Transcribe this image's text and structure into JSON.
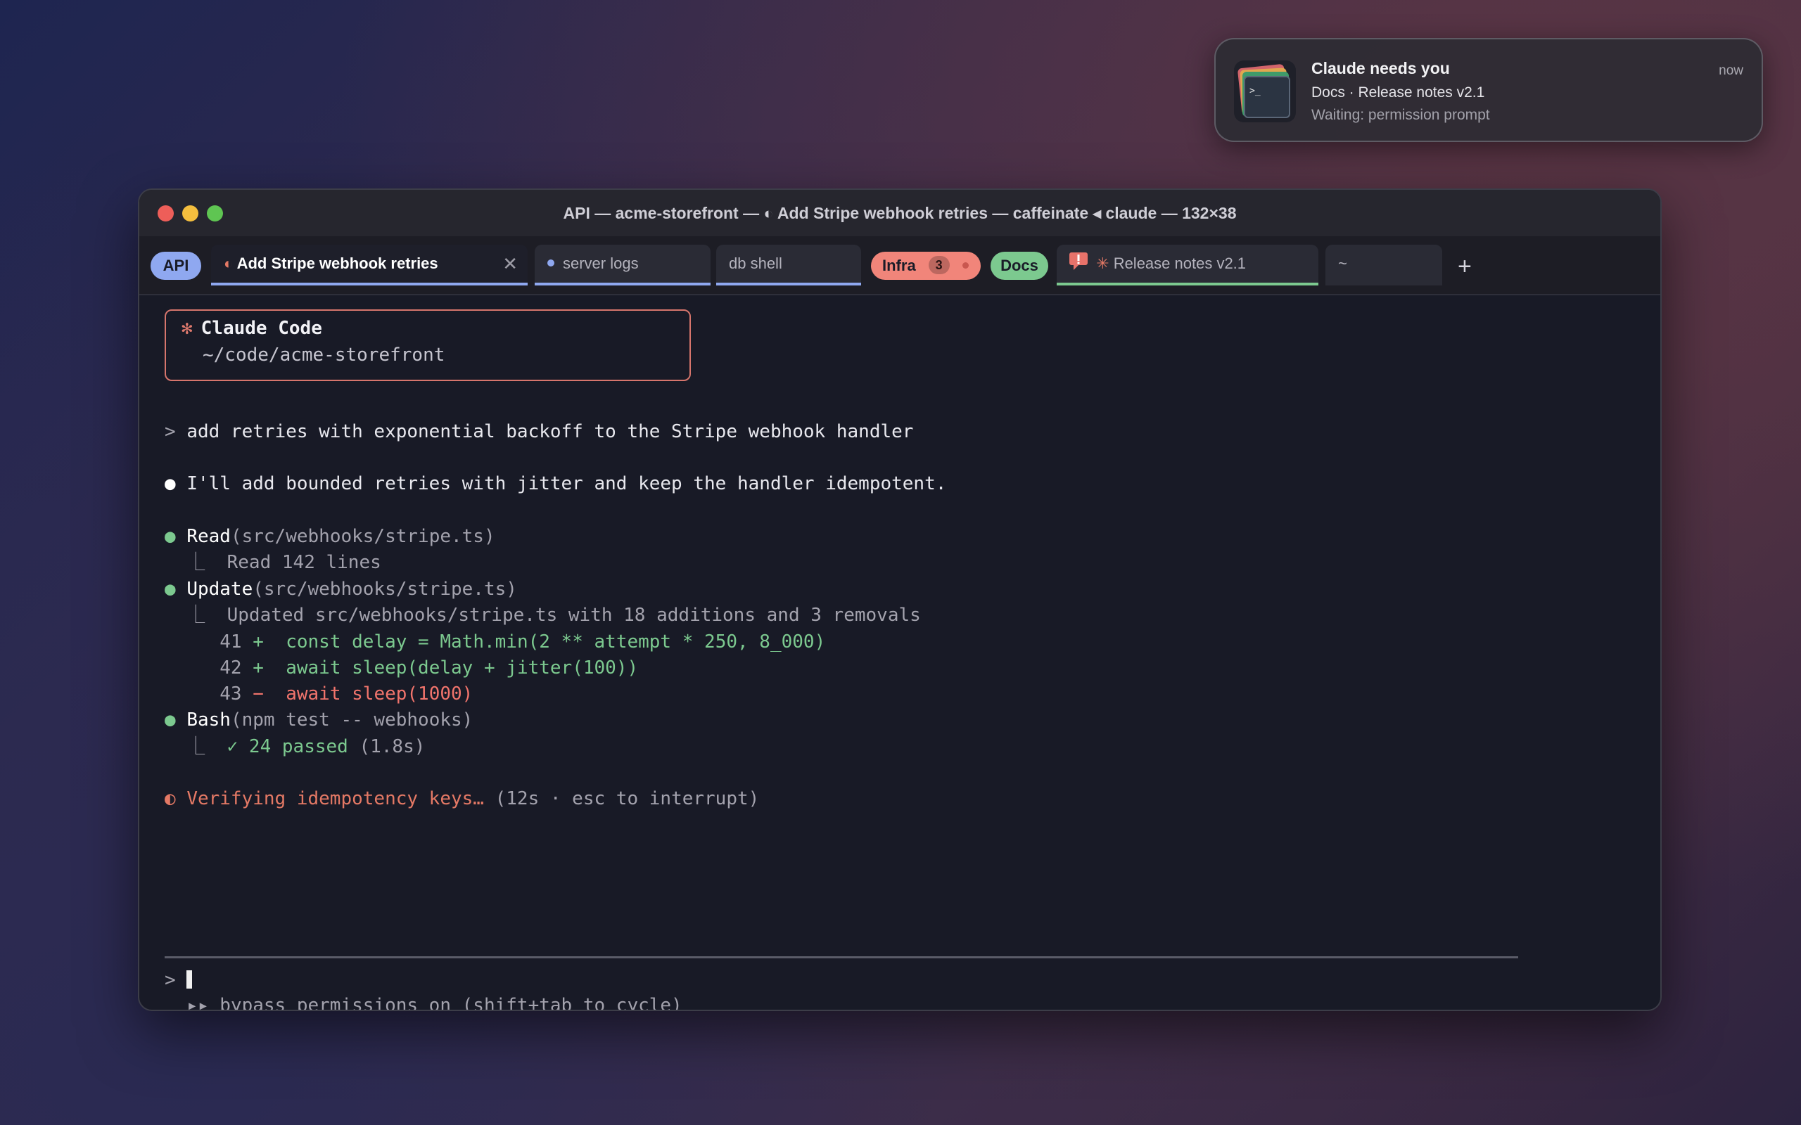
{
  "notification": {
    "title": "Claude needs you",
    "time": "now",
    "line1": "Docs · Release notes v2.1",
    "line2": "Waiting: permission prompt",
    "icon": "terminal-app-icon",
    "icon_prompt": ">_"
  },
  "window": {
    "title": "API — acme-storefront — ◐ Add Stripe webhook retries — caffeinate ◂ claude — 132×38"
  },
  "tabs": {
    "group_api": "API",
    "tab1": {
      "icon": "◐",
      "label": "Add Stripe webhook retries",
      "close": "✕",
      "active": true,
      "accent": "#8fa8f0"
    },
    "tab2": {
      "label": "server logs",
      "accent": "#8fa8f0"
    },
    "tab3": {
      "label": "db shell",
      "accent": "#8fa8f0"
    },
    "group_infra": "Infra",
    "infra_count": "3",
    "group_docs": "Docs",
    "tab4": {
      "icon": "✳",
      "label": "Release notes v2.1",
      "accent": "#7cc98f",
      "alert_icon": "alert-bubble-icon"
    },
    "tab5": {
      "label": "~"
    },
    "new_tab": "+"
  },
  "colors": {
    "api_group": "#8fa8f0",
    "infra_group": "#f1857a",
    "docs_group": "#7cc98f"
  },
  "terminal": {
    "banner_star": "✻",
    "banner_title": "Claude Code",
    "banner_path": "~/code/acme-storefront",
    "prompt": "add retries with exponential backoff to the Stripe webhook handler",
    "reply": "I'll add bounded retries with jitter and keep the handler idempotent.",
    "read_tool": "Read",
    "read_arg": "(src/webhooks/stripe.ts)",
    "read_result": "Read 142 lines",
    "update_tool": "Update",
    "update_arg": "(src/webhooks/stripe.ts)",
    "update_result": "Updated src/webhooks/stripe.ts with 18 additions and 3 removals",
    "diff": [
      {
        "num": "41",
        "sign": "+",
        "code": "const delay = Math.min(2 ** attempt * 250, 8_000)"
      },
      {
        "num": "42",
        "sign": "+",
        "code": "await sleep(delay + jitter(100))"
      },
      {
        "num": "43",
        "sign": "−",
        "code": "await sleep(1000)"
      }
    ],
    "bash_tool": "Bash",
    "bash_arg": "(npm test -- webhooks)",
    "bash_result": "✓ 24 passed",
    "bash_time": "(1.8s)",
    "status_icon": "◐",
    "status": "Verifying idempotency keys…",
    "status_meta": "(12s · esc to interrupt)",
    "input_prompt": ">",
    "mode_hint": "▸▸ bypass permissions on (shift+tab to cycle)"
  }
}
